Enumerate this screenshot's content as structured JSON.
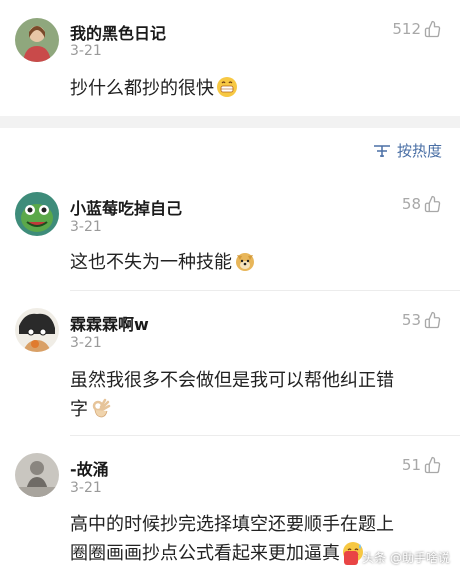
{
  "comments": [
    {
      "username": "我的黑色日记",
      "time": "3-21",
      "likes": "512",
      "text": "抄什么都抄的很快",
      "emoji": "grinning-face-emoji"
    },
    {
      "username": "小蓝莓吃掉自己",
      "time": "3-21",
      "likes": "58",
      "text": "这也不失为一种技能",
      "emoji": "doge-emoji"
    },
    {
      "username": "霖霖霖啊w",
      "time": "3-21",
      "likes": "53",
      "text_line1": "虽然我很多不会做但是我可以帮他纠正错",
      "text_line2": "字",
      "emoji": "ok-hand-emoji"
    },
    {
      "username": "-故涌",
      "time": "3-21",
      "likes": "51",
      "text_line1": "高中的时候抄完选择填空还要顺手在题上",
      "text_line2": "圈圈画画抄点公式看起来更加逼真",
      "emoji": "sweat-smile-emoji"
    }
  ],
  "sort": {
    "label": "按热度",
    "icon": "sort-icon"
  },
  "watermark": {
    "text": "头条 @助手啥说"
  },
  "colors": {
    "accent": "#4a6fa5",
    "muted": "#9a9a9a",
    "divider": "#f2f2f2"
  }
}
